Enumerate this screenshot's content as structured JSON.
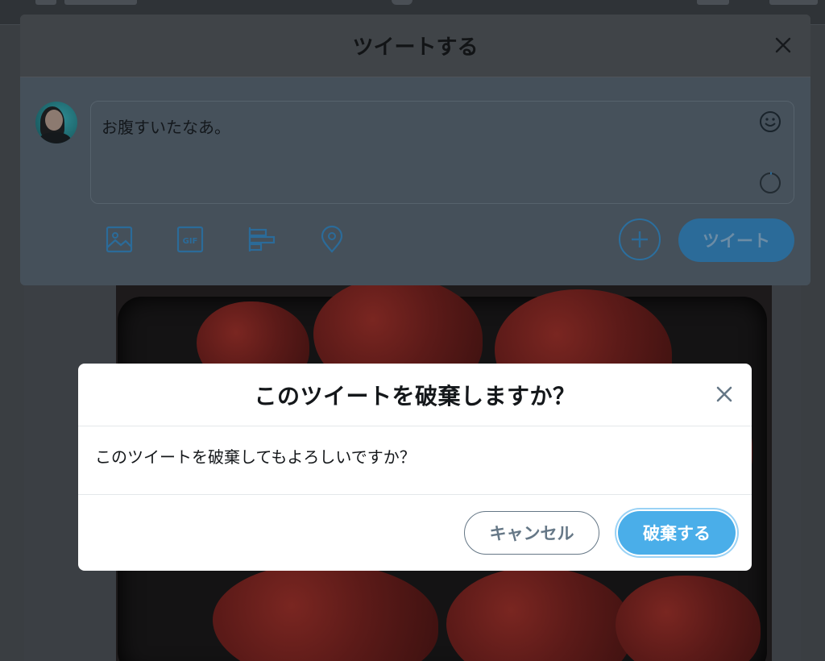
{
  "compose": {
    "title": "ツイートする",
    "tweet_text": "お腹すいたなあ。",
    "tweet_button": "ツイート",
    "tools": [
      "image-icon",
      "gif-icon",
      "poll-icon",
      "location-icon"
    ]
  },
  "dialog": {
    "title": "このツイートを破棄しますか？",
    "message": "このツイートを破棄してもよろしいですか？",
    "cancel_label": "キャンセル",
    "discard_label": "破棄する"
  },
  "colors": {
    "accent": "#4aaee9",
    "text": "#14171a",
    "muted": "#657786"
  }
}
